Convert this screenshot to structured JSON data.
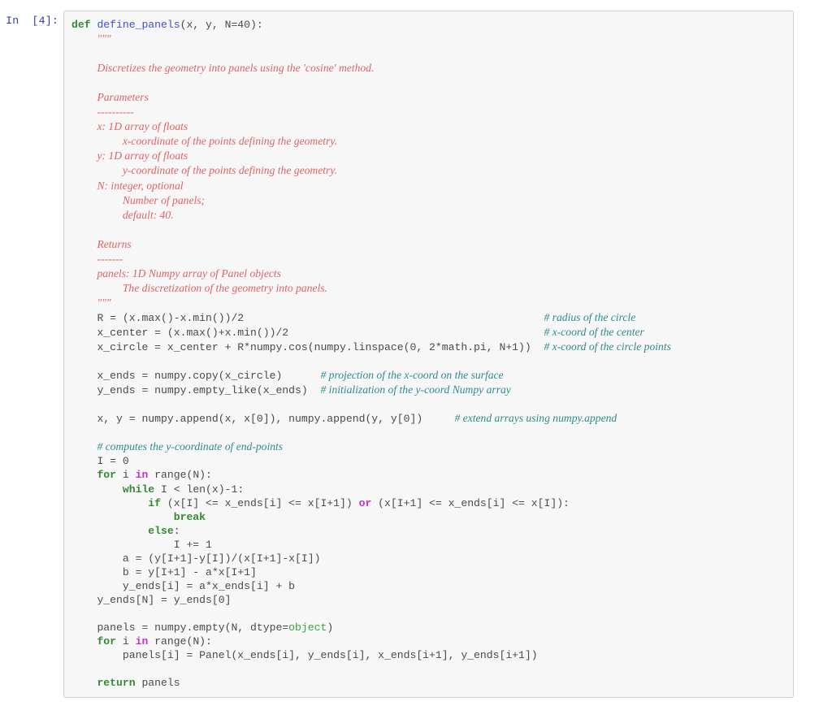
{
  "cell": {
    "prompt": "In  [4]:",
    "execution_count": 4,
    "type": "code",
    "language": "python"
  },
  "colors": {
    "background": "#ffffff",
    "cell_background": "#f7f7f7",
    "cell_border": "#cfcfcf",
    "prompt_text": "#303f9f",
    "code_text": "#4a4a4a",
    "keyword": "#338a33",
    "operator_word": "#c832c8",
    "function_name": "#3f4fd4",
    "builtin": "#39a539",
    "comment": "#2e8b8b",
    "docstring": "#e06464"
  },
  "code": {
    "lines": [
      {
        "indent": 0,
        "tokens": [
          {
            "t": "k",
            "v": "def"
          },
          {
            "t": "n",
            "v": " "
          },
          {
            "t": "nf",
            "v": "define_panels"
          },
          {
            "t": "n",
            "v": "(x, y, N=40):"
          }
        ]
      },
      {
        "indent": 4,
        "tokens": [
          {
            "t": "sd",
            "v": "\"\"\""
          }
        ]
      },
      {
        "indent": 4,
        "tokens": [
          {
            "t": "sd",
            "v": ""
          }
        ]
      },
      {
        "indent": 4,
        "tokens": [
          {
            "t": "sd",
            "v": "Discretizes the geometry into panels using the 'cosine' method."
          }
        ]
      },
      {
        "indent": 4,
        "tokens": [
          {
            "t": "sd",
            "v": ""
          }
        ]
      },
      {
        "indent": 4,
        "tokens": [
          {
            "t": "sd",
            "v": "Parameters"
          }
        ]
      },
      {
        "indent": 4,
        "tokens": [
          {
            "t": "sd",
            "v": "----------"
          }
        ]
      },
      {
        "indent": 4,
        "tokens": [
          {
            "t": "sd",
            "v": "x: 1D array of floats"
          }
        ]
      },
      {
        "indent": 8,
        "tokens": [
          {
            "t": "sd",
            "v": "x-coordinate of the points defining the geometry."
          }
        ]
      },
      {
        "indent": 4,
        "tokens": [
          {
            "t": "sd",
            "v": "y: 1D array of floats"
          }
        ]
      },
      {
        "indent": 8,
        "tokens": [
          {
            "t": "sd",
            "v": "y-coordinate of the points defining the geometry."
          }
        ]
      },
      {
        "indent": 4,
        "tokens": [
          {
            "t": "sd",
            "v": "N: integer, optional"
          }
        ]
      },
      {
        "indent": 8,
        "tokens": [
          {
            "t": "sd",
            "v": "Number of panels;"
          }
        ]
      },
      {
        "indent": 8,
        "tokens": [
          {
            "t": "sd",
            "v": "default: 40."
          }
        ]
      },
      {
        "indent": 4,
        "tokens": [
          {
            "t": "sd",
            "v": ""
          }
        ]
      },
      {
        "indent": 4,
        "tokens": [
          {
            "t": "sd",
            "v": "Returns"
          }
        ]
      },
      {
        "indent": 4,
        "tokens": [
          {
            "t": "sd",
            "v": "-------"
          }
        ]
      },
      {
        "indent": 4,
        "tokens": [
          {
            "t": "sd",
            "v": "panels: 1D Numpy array of Panel objects"
          }
        ]
      },
      {
        "indent": 8,
        "tokens": [
          {
            "t": "sd",
            "v": "The discretization of the geometry into panels."
          }
        ]
      },
      {
        "indent": 4,
        "tokens": [
          {
            "t": "sd",
            "v": "\"\"\""
          }
        ]
      },
      {
        "indent": 4,
        "tokens": [
          {
            "t": "n",
            "v": "R = (x.max()-x.min())/2"
          },
          {
            "t": "pad",
            "v": "__PAD47__"
          },
          {
            "t": "c1",
            "v": "# radius of the circle"
          }
        ]
      },
      {
        "indent": 4,
        "tokens": [
          {
            "t": "n",
            "v": "x_center = (x.max()+x.min())/2"
          },
          {
            "t": "pad",
            "v": "__PAD40__"
          },
          {
            "t": "c1",
            "v": "# x-coord of the center"
          }
        ]
      },
      {
        "indent": 4,
        "tokens": [
          {
            "t": "n",
            "v": "x_circle = x_center + R*numpy.cos(numpy.linspace(0, 2*math.pi, N+1))"
          },
          {
            "t": "pad",
            "v": "__PAD2__"
          },
          {
            "t": "c1",
            "v": "# x-coord of the circle points"
          }
        ]
      },
      {
        "indent": 4,
        "tokens": [
          {
            "t": "n",
            "v": ""
          }
        ]
      },
      {
        "indent": 4,
        "tokens": [
          {
            "t": "n",
            "v": "x_ends = numpy.copy(x_circle)"
          },
          {
            "t": "pad",
            "v": "__PAD6__"
          },
          {
            "t": "c1",
            "v": "# projection of the x-coord on the surface"
          }
        ]
      },
      {
        "indent": 4,
        "tokens": [
          {
            "t": "n",
            "v": "y_ends = numpy.empty_like(x_ends)"
          },
          {
            "t": "pad",
            "v": "__PAD2__"
          },
          {
            "t": "c1",
            "v": "# initialization of the y-coord Numpy array"
          }
        ]
      },
      {
        "indent": 4,
        "tokens": [
          {
            "t": "n",
            "v": ""
          }
        ]
      },
      {
        "indent": 4,
        "tokens": [
          {
            "t": "n",
            "v": "x, y = numpy.append(x, x[0]), numpy.append(y, y[0])"
          },
          {
            "t": "pad",
            "v": "__PAD5__"
          },
          {
            "t": "c1",
            "v": "# extend arrays using numpy.append"
          }
        ]
      },
      {
        "indent": 4,
        "tokens": [
          {
            "t": "n",
            "v": ""
          }
        ]
      },
      {
        "indent": 4,
        "tokens": [
          {
            "t": "c1",
            "v": "# computes the y-coordinate of end-points"
          }
        ]
      },
      {
        "indent": 4,
        "tokens": [
          {
            "t": "n",
            "v": "I = 0"
          }
        ]
      },
      {
        "indent": 4,
        "tokens": [
          {
            "t": "k",
            "v": "for"
          },
          {
            "t": "n",
            "v": " i "
          },
          {
            "t": "ow",
            "v": "in"
          },
          {
            "t": "n",
            "v": " range(N):"
          }
        ]
      },
      {
        "indent": 8,
        "tokens": [
          {
            "t": "k",
            "v": "while"
          },
          {
            "t": "n",
            "v": " I < len(x)-1:"
          }
        ]
      },
      {
        "indent": 12,
        "tokens": [
          {
            "t": "k",
            "v": "if"
          },
          {
            "t": "n",
            "v": " (x[I] <= x_ends[i] <= x[I+1]) "
          },
          {
            "t": "ow",
            "v": "or"
          },
          {
            "t": "n",
            "v": " (x[I+1] <= x_ends[i] <= x[I]):"
          }
        ]
      },
      {
        "indent": 16,
        "tokens": [
          {
            "t": "k",
            "v": "break"
          }
        ]
      },
      {
        "indent": 12,
        "tokens": [
          {
            "t": "k",
            "v": "else"
          },
          {
            "t": "n",
            "v": ":"
          }
        ]
      },
      {
        "indent": 16,
        "tokens": [
          {
            "t": "n",
            "v": "I += 1"
          }
        ]
      },
      {
        "indent": 8,
        "tokens": [
          {
            "t": "n",
            "v": "a = (y[I+1]-y[I])/(x[I+1]-x[I])"
          }
        ]
      },
      {
        "indent": 8,
        "tokens": [
          {
            "t": "n",
            "v": "b = y[I+1] - a*x[I+1]"
          }
        ]
      },
      {
        "indent": 8,
        "tokens": [
          {
            "t": "n",
            "v": "y_ends[i] = a*x_ends[i] + b"
          }
        ]
      },
      {
        "indent": 4,
        "tokens": [
          {
            "t": "n",
            "v": "y_ends[N] = y_ends[0]"
          }
        ]
      },
      {
        "indent": 4,
        "tokens": [
          {
            "t": "n",
            "v": ""
          }
        ]
      },
      {
        "indent": 4,
        "tokens": [
          {
            "t": "n",
            "v": "panels = numpy.empty(N, dtype="
          },
          {
            "t": "nb",
            "v": "object"
          },
          {
            "t": "n",
            "v": ")"
          }
        ]
      },
      {
        "indent": 4,
        "tokens": [
          {
            "t": "k",
            "v": "for"
          },
          {
            "t": "n",
            "v": " i "
          },
          {
            "t": "ow",
            "v": "in"
          },
          {
            "t": "n",
            "v": " range(N):"
          }
        ]
      },
      {
        "indent": 8,
        "tokens": [
          {
            "t": "n",
            "v": "panels[i] = Panel(x_ends[i], y_ends[i], x_ends[i+1], y_ends[i+1])"
          }
        ]
      },
      {
        "indent": 4,
        "tokens": [
          {
            "t": "n",
            "v": ""
          }
        ]
      },
      {
        "indent": 4,
        "tokens": [
          {
            "t": "k",
            "v": "return"
          },
          {
            "t": "n",
            "v": " panels"
          }
        ]
      }
    ]
  }
}
